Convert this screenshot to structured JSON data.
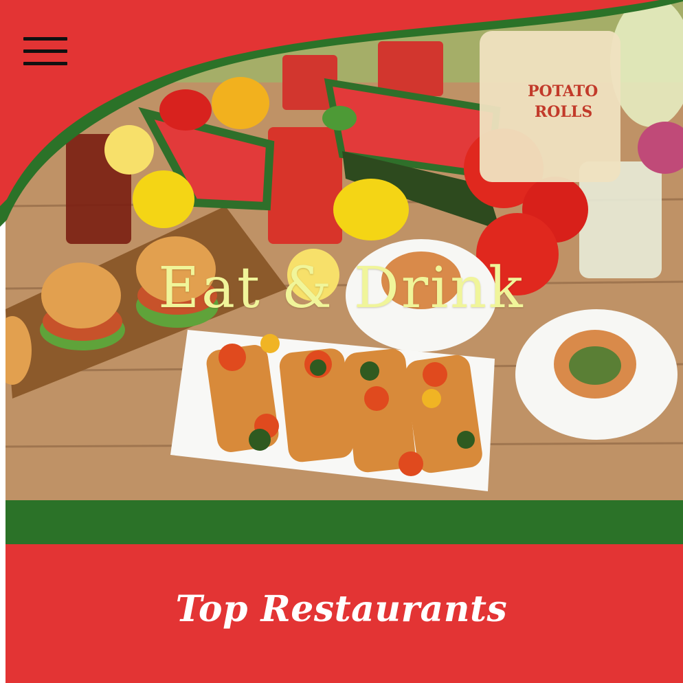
{
  "header": {
    "menu_icon": "hamburger-menu-icon"
  },
  "hero": {
    "title": "Eat & Drink",
    "image_description_icons": [
      "watermelon",
      "lemon",
      "burger",
      "skewer",
      "tomato",
      "drink-glass"
    ]
  },
  "section": {
    "title": "Top Restaurants"
  },
  "colors": {
    "brand_red": "#e33434",
    "brand_green": "#2b7228",
    "hero_title": "#f0f59a",
    "section_title": "#ffffff"
  }
}
